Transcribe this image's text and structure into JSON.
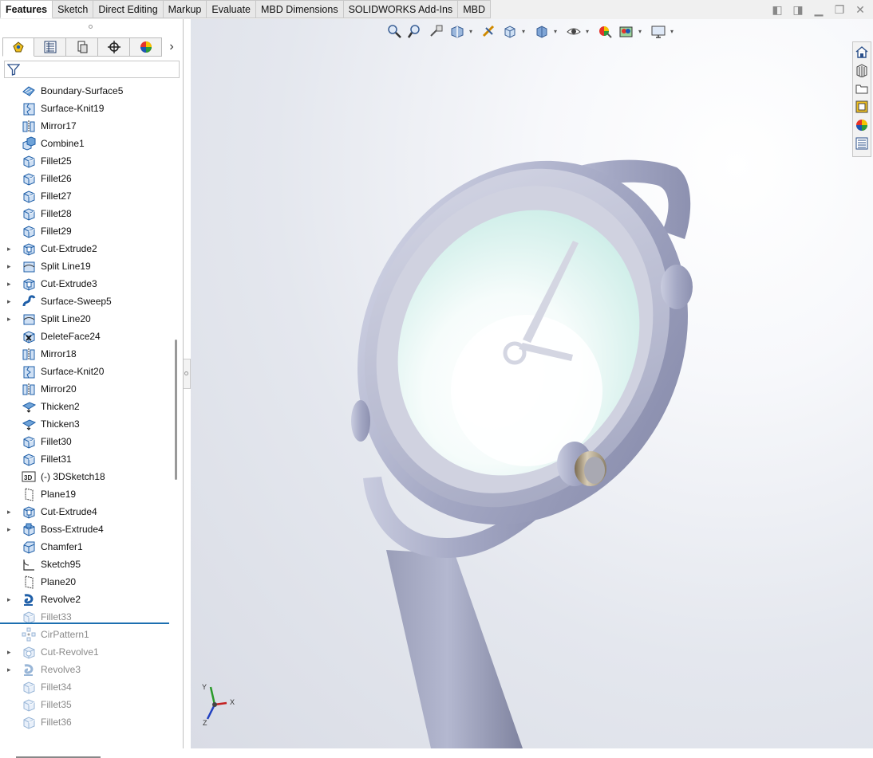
{
  "tabs": [
    "Features",
    "Sketch",
    "Direct Editing",
    "Markup",
    "Evaluate",
    "MBD Dimensions",
    "SOLIDWORKS Add-Ins",
    "MBD"
  ],
  "active_tab": "Features",
  "panel_tabs": [
    "feature-manager-icon",
    "property-manager-icon",
    "configuration-manager-icon",
    "dimxpert-icon",
    "display-manager-icon"
  ],
  "feature_tree": [
    {
      "label": "Boundary-Surface5",
      "icon": "boundary-surface-icon",
      "expandable": false,
      "suppressed": false
    },
    {
      "label": "Surface-Knit19",
      "icon": "surface-knit-icon",
      "expandable": false,
      "suppressed": false
    },
    {
      "label": "Mirror17",
      "icon": "mirror-icon",
      "expandable": false,
      "suppressed": false
    },
    {
      "label": "Combine1",
      "icon": "combine-icon",
      "expandable": false,
      "suppressed": false
    },
    {
      "label": "Fillet25",
      "icon": "fillet-icon",
      "expandable": false,
      "suppressed": false
    },
    {
      "label": "Fillet26",
      "icon": "fillet-icon",
      "expandable": false,
      "suppressed": false
    },
    {
      "label": "Fillet27",
      "icon": "fillet-icon",
      "expandable": false,
      "suppressed": false
    },
    {
      "label": "Fillet28",
      "icon": "fillet-icon",
      "expandable": false,
      "suppressed": false
    },
    {
      "label": "Fillet29",
      "icon": "fillet-icon",
      "expandable": false,
      "suppressed": false
    },
    {
      "label": "Cut-Extrude2",
      "icon": "cut-extrude-icon",
      "expandable": true,
      "suppressed": false
    },
    {
      "label": "Split Line19",
      "icon": "split-line-icon",
      "expandable": true,
      "suppressed": false
    },
    {
      "label": "Cut-Extrude3",
      "icon": "cut-extrude-icon",
      "expandable": true,
      "suppressed": false
    },
    {
      "label": "Surface-Sweep5",
      "icon": "surface-sweep-icon",
      "expandable": true,
      "suppressed": false
    },
    {
      "label": "Split Line20",
      "icon": "split-line-icon",
      "expandable": true,
      "suppressed": false
    },
    {
      "label": "DeleteFace24",
      "icon": "delete-face-icon",
      "expandable": false,
      "suppressed": false
    },
    {
      "label": "Mirror18",
      "icon": "mirror-icon",
      "expandable": false,
      "suppressed": false
    },
    {
      "label": "Surface-Knit20",
      "icon": "surface-knit-icon",
      "expandable": false,
      "suppressed": false
    },
    {
      "label": "Mirror20",
      "icon": "mirror-icon",
      "expandable": false,
      "suppressed": false
    },
    {
      "label": "Thicken2",
      "icon": "thicken-icon",
      "expandable": false,
      "suppressed": false
    },
    {
      "label": "Thicken3",
      "icon": "thicken-icon",
      "expandable": false,
      "suppressed": false
    },
    {
      "label": "Fillet30",
      "icon": "fillet-icon",
      "expandable": false,
      "suppressed": false
    },
    {
      "label": "Fillet31",
      "icon": "fillet-icon",
      "expandable": false,
      "suppressed": false
    },
    {
      "label": "(-) 3DSketch18",
      "icon": "3d-sketch-icon",
      "expandable": false,
      "suppressed": false
    },
    {
      "label": "Plane19",
      "icon": "plane-icon",
      "expandable": false,
      "suppressed": false
    },
    {
      "label": "Cut-Extrude4",
      "icon": "cut-extrude-icon",
      "expandable": true,
      "suppressed": false
    },
    {
      "label": "Boss-Extrude4",
      "icon": "boss-extrude-icon",
      "expandable": true,
      "suppressed": false
    },
    {
      "label": "Chamfer1",
      "icon": "chamfer-icon",
      "expandable": false,
      "suppressed": false
    },
    {
      "label": "Sketch95",
      "icon": "sketch-icon",
      "expandable": false,
      "suppressed": false
    },
    {
      "label": "Plane20",
      "icon": "plane-icon",
      "expandable": false,
      "suppressed": false
    },
    {
      "label": "Revolve2",
      "icon": "revolve-icon",
      "expandable": true,
      "suppressed": false
    },
    {
      "label": "Fillet33",
      "icon": "fillet-icon",
      "expandable": false,
      "suppressed": true
    },
    {
      "label": "CirPattern1",
      "icon": "circular-pattern-icon",
      "expandable": false,
      "suppressed": true
    },
    {
      "label": "Cut-Revolve1",
      "icon": "cut-revolve-icon",
      "expandable": true,
      "suppressed": true
    },
    {
      "label": "Revolve3",
      "icon": "revolve-icon",
      "expandable": true,
      "suppressed": true
    },
    {
      "label": "Fillet34",
      "icon": "fillet-icon",
      "expandable": false,
      "suppressed": true
    },
    {
      "label": "Fillet35",
      "icon": "fillet-icon",
      "expandable": false,
      "suppressed": true
    },
    {
      "label": "Fillet36",
      "icon": "fillet-icon",
      "expandable": false,
      "suppressed": true
    }
  ],
  "heads_up_toolbar": [
    "zoom-to-fit-icon",
    "zoom-to-area-icon",
    "previous-view-icon",
    "section-view-icon",
    "dynamic-annotation-icon",
    "view-orientation-icon",
    "display-style-icon",
    "hide-show-items-icon",
    "edit-appearance-icon",
    "apply-scene-icon",
    "view-settings-icon"
  ],
  "task_pane": [
    "solidworks-resources-icon",
    "design-library-icon",
    "file-explorer-icon",
    "view-palette-icon",
    "appearances-icon",
    "custom-properties-icon"
  ],
  "triad_labels": {
    "x": "X",
    "y": "Y",
    "z": "Z"
  },
  "colors": {
    "accent": "#1c6fb0",
    "watch_body": "#a9adc8",
    "dial": "#e6f7f4"
  }
}
